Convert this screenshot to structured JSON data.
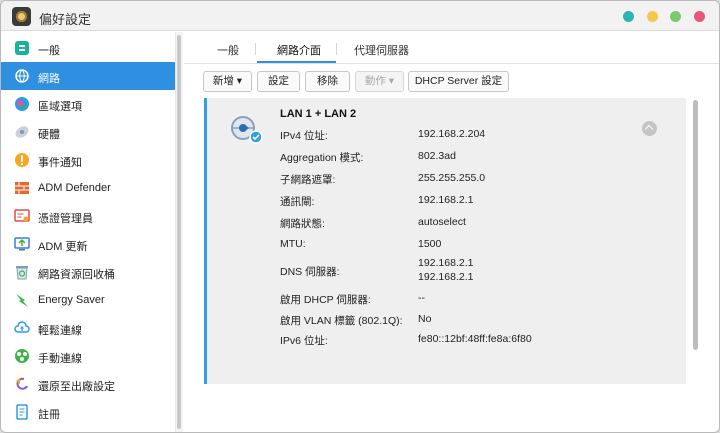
{
  "window": {
    "title": "偏好設定",
    "controls": {
      "teal": "#2fb3b3",
      "yellow": "#f2c94c",
      "green": "#7bc96f",
      "pink": "#e9557f"
    }
  },
  "sidebar": {
    "items": [
      {
        "label": "一般",
        "icon": "general-icon",
        "color": "#19b39a"
      },
      {
        "label": "網路",
        "icon": "network-icon",
        "color": "#ffffff",
        "active": true
      },
      {
        "label": "區域選項",
        "icon": "region-icon",
        "color": "#2e9be6"
      },
      {
        "label": "硬體",
        "icon": "hardware-icon",
        "color": "#9aa7b8"
      },
      {
        "label": "事件通知",
        "icon": "notification-icon",
        "color": "#f5a623"
      },
      {
        "label": "ADM Defender",
        "icon": "defender-icon",
        "color": "#e8672e"
      },
      {
        "label": "憑證管理員",
        "icon": "certificate-icon",
        "color": "#e64a4a"
      },
      {
        "label": "ADM 更新",
        "icon": "update-icon",
        "color": "#3a7bd5"
      },
      {
        "label": "網路資源回收桶",
        "icon": "recycle-bin-icon",
        "color": "#7aa0b5"
      },
      {
        "label": "Energy Saver",
        "icon": "energy-saver-icon",
        "color": "#3db34a"
      },
      {
        "label": "輕鬆連線",
        "icon": "easy-connect-icon",
        "color": "#2e9be6"
      },
      {
        "label": "手動連線",
        "icon": "manual-connect-icon",
        "color": "#3db34a"
      },
      {
        "label": "還原至出廠設定",
        "icon": "factory-reset-icon",
        "color": "#8a5cc7"
      },
      {
        "label": "註冊",
        "icon": "register-icon",
        "color": "#2e9be6"
      }
    ]
  },
  "tabs": [
    {
      "label": "一般"
    },
    {
      "label": "網路介面",
      "active": true
    },
    {
      "label": "代理伺服器"
    }
  ],
  "toolbar": {
    "add": "新增 ▾",
    "settings": "設定",
    "remove": "移除",
    "action": "動作 ▾",
    "dhcp": "DHCP Server 設定"
  },
  "interface": {
    "title": "LAN 1 + LAN 2",
    "rows": [
      {
        "label": "IPv4 位址:",
        "value": "192.168.2.204"
      },
      {
        "label": "Aggregation 模式:",
        "value": "802.3ad"
      },
      {
        "label": "子網路遮罩:",
        "value": "255.255.255.0"
      },
      {
        "label": "通訊閘:",
        "value": "192.168.2.1"
      },
      {
        "label": "網路狀態:",
        "value": "autoselect"
      },
      {
        "label": "MTU:",
        "value": "1500"
      },
      {
        "label": "DNS 伺服器:",
        "value": "192.168.2.1",
        "value2": "192.168.2.1"
      },
      {
        "label": "啟用 DHCP 伺服器:",
        "value": "--"
      },
      {
        "label": "啟用 VLAN 標籤 (802.1Q):",
        "value": "No"
      },
      {
        "label": "IPv6 位址:",
        "value": "fe80::12bf:48ff:fe8a:6f80"
      }
    ]
  },
  "colors": {
    "accent": "#2f8fe0",
    "panel_border": "#2f9fe0"
  }
}
